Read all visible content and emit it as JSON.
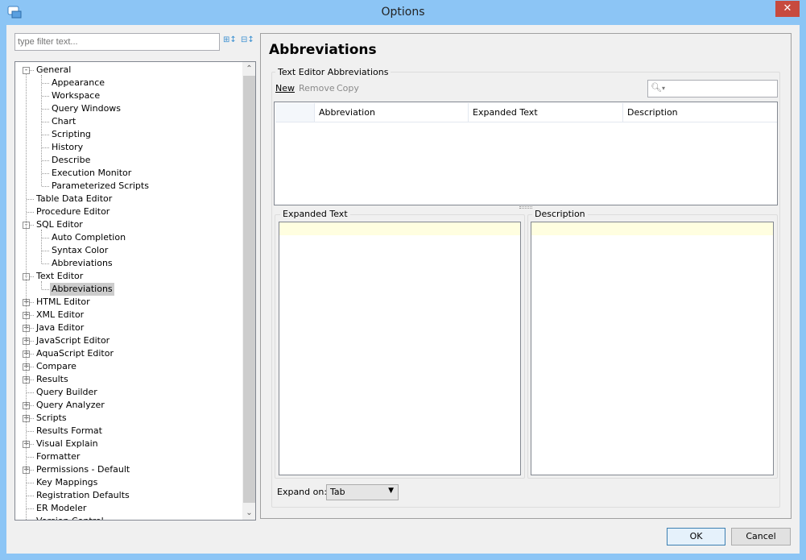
{
  "window": {
    "title": "Options",
    "close_icon": "close-icon"
  },
  "filter": {
    "placeholder": "type filter text..."
  },
  "tree": [
    {
      "label": "General",
      "level": 0,
      "expander": "-"
    },
    {
      "label": "Appearance",
      "level": 1
    },
    {
      "label": "Workspace",
      "level": 1
    },
    {
      "label": "Query Windows",
      "level": 1
    },
    {
      "label": "Chart",
      "level": 1
    },
    {
      "label": "Scripting",
      "level": 1
    },
    {
      "label": "History",
      "level": 1
    },
    {
      "label": "Describe",
      "level": 1
    },
    {
      "label": "Execution Monitor",
      "level": 1
    },
    {
      "label": "Parameterized Scripts",
      "level": 1
    },
    {
      "label": "Table Data Editor",
      "level": 0
    },
    {
      "label": "Procedure Editor",
      "level": 0
    },
    {
      "label": "SQL Editor",
      "level": 0,
      "expander": "-"
    },
    {
      "label": "Auto Completion",
      "level": 1
    },
    {
      "label": "Syntax Color",
      "level": 1
    },
    {
      "label": "Abbreviations",
      "level": 1
    },
    {
      "label": "Text Editor",
      "level": 0,
      "expander": "-"
    },
    {
      "label": "Abbreviations",
      "level": 1,
      "selected": true
    },
    {
      "label": "HTML Editor",
      "level": 0,
      "expander": "+"
    },
    {
      "label": "XML Editor",
      "level": 0,
      "expander": "+"
    },
    {
      "label": "Java Editor",
      "level": 0,
      "expander": "+"
    },
    {
      "label": "JavaScript Editor",
      "level": 0,
      "expander": "+"
    },
    {
      "label": "AquaScript Editor",
      "level": 0,
      "expander": "+"
    },
    {
      "label": "Compare",
      "level": 0,
      "expander": "+"
    },
    {
      "label": "Results",
      "level": 0,
      "expander": "+"
    },
    {
      "label": "Query Builder",
      "level": 0
    },
    {
      "label": "Query Analyzer",
      "level": 0,
      "expander": "+"
    },
    {
      "label": "Scripts",
      "level": 0,
      "expander": "+"
    },
    {
      "label": "Results Format",
      "level": 0
    },
    {
      "label": "Visual Explain",
      "level": 0,
      "expander": "+"
    },
    {
      "label": "Formatter",
      "level": 0
    },
    {
      "label": "Permissions - Default",
      "level": 0,
      "expander": "+"
    },
    {
      "label": "Key Mappings",
      "level": 0
    },
    {
      "label": "Registration Defaults",
      "level": 0
    },
    {
      "label": "ER Modeler",
      "level": 0
    },
    {
      "label": "Version Control",
      "level": 0
    }
  ],
  "main": {
    "heading": "Abbreviations",
    "group_label": "Text Editor Abbreviations",
    "toolbar": {
      "new": "New",
      "remove": "Remove",
      "copy": "Copy"
    },
    "search": {
      "icon": "search-icon",
      "value": "▾"
    },
    "table": {
      "columns": [
        "Abbreviation",
        "Expanded Text",
        "Description"
      ]
    },
    "expanded_text_label": "Expanded Text",
    "description_label": "Description",
    "expand_on_label": "Expand on:",
    "expand_on_value": "Tab"
  },
  "buttons": {
    "ok": "OK",
    "cancel": "Cancel"
  }
}
